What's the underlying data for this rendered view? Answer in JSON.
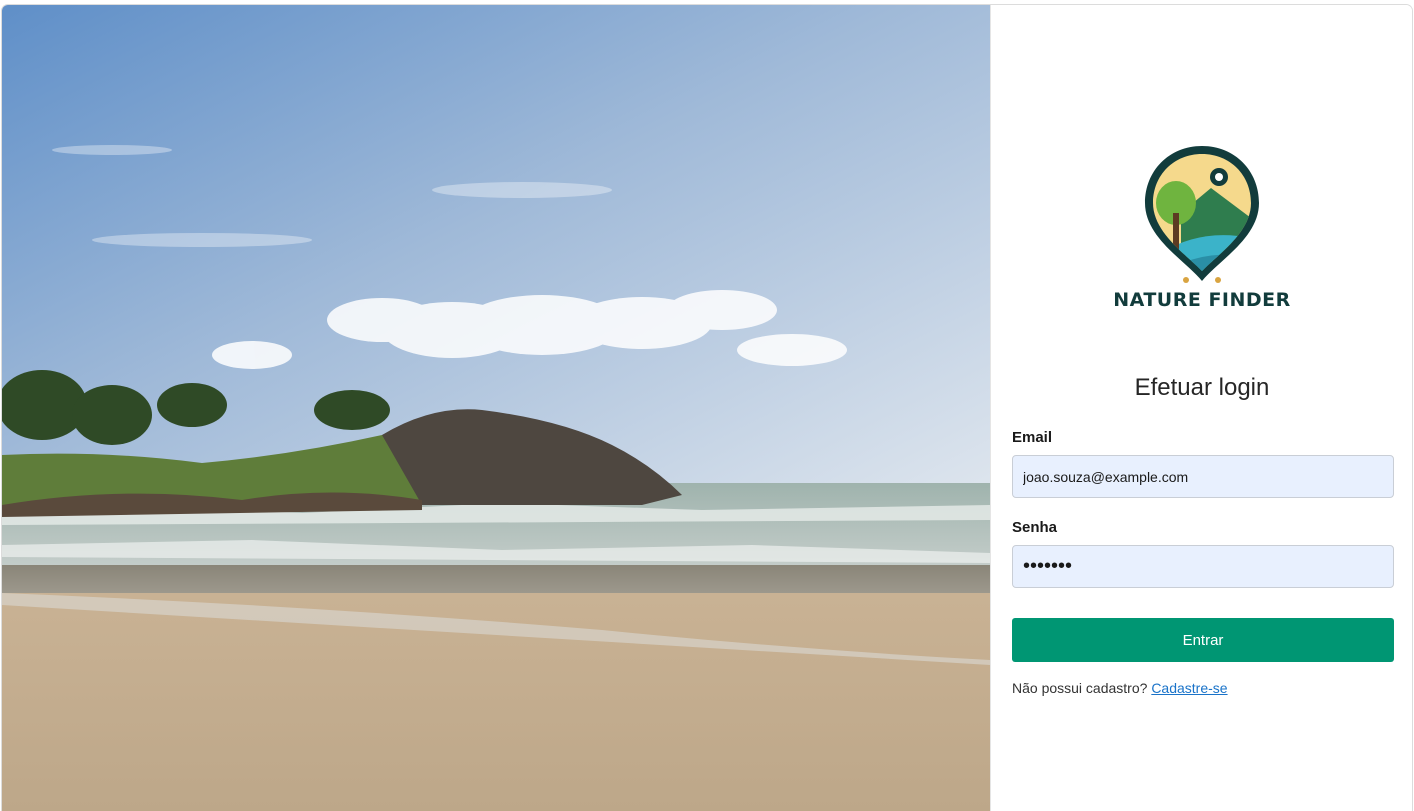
{
  "brand": {
    "name": "NATURE FINDER",
    "logo_icon": "location-pin-landscape-icon",
    "primary_color": "#009673",
    "brand_color": "#123c3c"
  },
  "hero": {
    "image": "beach-landscape-photo"
  },
  "login": {
    "title": "Efetuar login",
    "email_label": "Email",
    "email_value": "joao.souza@example.com",
    "password_label": "Senha",
    "password_value": "•••••••",
    "submit_label": "Entrar",
    "signup_prompt": "Não possui cadastro?",
    "signup_link": "Cadastre-se"
  }
}
